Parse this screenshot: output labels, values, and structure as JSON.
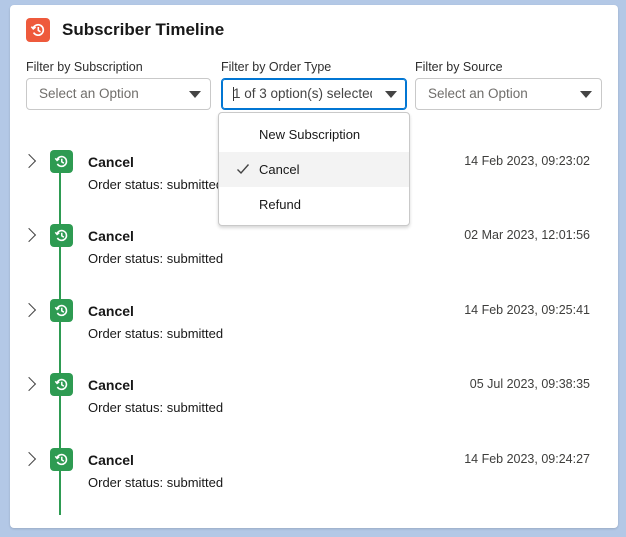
{
  "header": {
    "title": "Subscriber Timeline",
    "icon": "history-icon",
    "icon_color": "#ee5a3c"
  },
  "filters": [
    {
      "label": "Filter by Subscription",
      "value": "",
      "placeholder": "Select an Option"
    },
    {
      "label": "Filter by Order Type",
      "value": "1 of 3 option(s) selected",
      "placeholder": "Select an Option",
      "focused": true
    },
    {
      "label": "Filter by Source",
      "value": "",
      "placeholder": "Select an Option"
    }
  ],
  "dropdown": {
    "options": [
      {
        "label": "New Subscription",
        "selected": false
      },
      {
        "label": "Cancel",
        "selected": true
      },
      {
        "label": "Refund",
        "selected": false
      }
    ]
  },
  "timeline": {
    "accent": "#2e9b52",
    "items": [
      {
        "title": "Cancel",
        "status": "Order status: submitted",
        "date": "14 Feb 2023, 09:23:02"
      },
      {
        "title": "Cancel",
        "status": "Order status: submitted",
        "date": "02 Mar 2023, 12:01:56"
      },
      {
        "title": "Cancel",
        "status": "Order status: submitted",
        "date": "14 Feb 2023, 09:25:41"
      },
      {
        "title": "Cancel",
        "status": "Order status: submitted",
        "date": "05 Jul 2023, 09:38:35"
      },
      {
        "title": "Cancel",
        "status": "Order status: submitted",
        "date": "14 Feb 2023, 09:24:27"
      }
    ]
  }
}
